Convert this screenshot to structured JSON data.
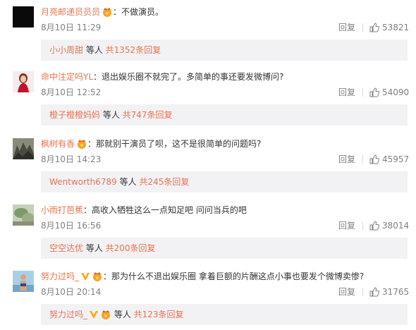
{
  "comments": [
    {
      "user": "月亮邮递员员员",
      "badge": "vip-crown-badge",
      "sep": "：",
      "text": "不做演员。",
      "time": "8月10日 11:29",
      "reply_label": "回复",
      "likes": "53821",
      "sub": {
        "user": "小小周甜",
        "mid": " 等人 ",
        "count": "共1352条回复"
      }
    },
    {
      "user": "命中注定吗YL",
      "badge": "",
      "sep": "：",
      "text": "退出娱乐圈不就完了。多简单的事还要发微博问?",
      "time": "8月10日 12:52",
      "reply_label": "回复",
      "likes": "54090",
      "sub": {
        "user": "橙子橙橙妈妈",
        "mid": " 等人 ",
        "count": "共747条回复"
      }
    },
    {
      "user": "枫树有香",
      "badge": "vip-crown-badge",
      "sep": "：",
      "text": "那就别干演员了呗，这不是很简单的问题吗?",
      "time": "8月10日 14:23",
      "reply_label": "回复",
      "likes": "45957",
      "sub": {
        "user": "Wentworth6789",
        "mid": " 等人 ",
        "count": "共245条回复"
      }
    },
    {
      "user": "小雨打芭蕉",
      "badge": "",
      "sep": "：",
      "text": "高收入牺牲这么一点知足吧  问问当兵的吧",
      "time": "8月10日 16:56",
      "reply_label": "回复",
      "likes": "38014",
      "sub": {
        "user": "空空达优",
        "mid": " 等人 ",
        "count": "共200条回复"
      }
    },
    {
      "user": "努力过吗_",
      "badge": "vip-crown-badge",
      "sep": "：",
      "text": "那为什么不退出娱乐圈 拿着巨额的片酬这点小事也要发个微博卖惨?",
      "time": "8月10日 20:14",
      "reply_label": "回复",
      "likes": "31765",
      "sub": {
        "user": "努力过吗_",
        "mid": " 等人 ",
        "count": "共123条回复"
      }
    }
  ],
  "colors": {
    "username": "#eb7350",
    "meta": "#808080",
    "subbox_bg": "#f2f2f5",
    "badge": "#f5a623",
    "v_badge": "#ffa500"
  }
}
